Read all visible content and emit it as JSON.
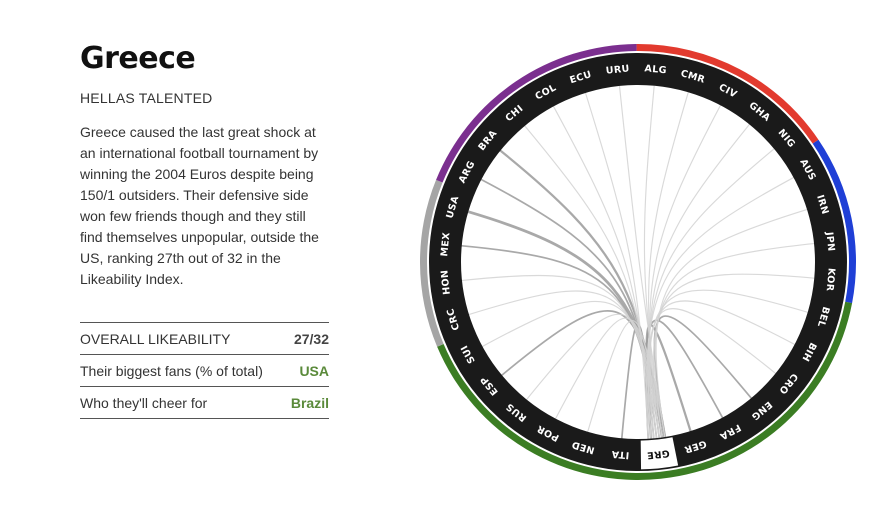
{
  "team": {
    "name": "Greece",
    "tagline": "HELLAS TALENTED",
    "description": "Greece caused the last great shock at an international football tournament by winning the 2004 Euros despite being 150/1 outsiders. Their defensive side won few friends though and they still find themselves unpopular, outside the US, ranking 27th out of 32 in the Likeability Index."
  },
  "stats": [
    {
      "label": "OVERALL LIKEABILITY",
      "value": "27/32",
      "style": "rank"
    },
    {
      "label": "Their biggest fans (% of total)",
      "value": "USA",
      "style": "green"
    },
    {
      "label": "Who they'll cheer for",
      "value": "Brazil",
      "style": "green"
    }
  ],
  "chart_data": {
    "type": "chord",
    "selected": "GRE",
    "teams": [
      "URU",
      "ALG",
      "CMR",
      "CIV",
      "GHA",
      "NIG",
      "AUS",
      "IRN",
      "JPN",
      "KOR",
      "BEL",
      "BIH",
      "CRO",
      "ENG",
      "FRA",
      "GER",
      "GRE",
      "ITA",
      "NED",
      "POR",
      "RUS",
      "ESP",
      "SUI",
      "CRC",
      "HON",
      "MEX",
      "USA",
      "ARG",
      "BRA",
      "CHI",
      "COL",
      "ECU"
    ],
    "groups": [
      {
        "color": "#e23a2e",
        "teams": [
          "ALG",
          "CMR",
          "CIV",
          "GHA",
          "NIG"
        ]
      },
      {
        "color": "#1f3fd6",
        "teams": [
          "AUS",
          "IRN",
          "JPN",
          "KOR"
        ]
      },
      {
        "color": "#3b7d23",
        "teams": [
          "BEL",
          "BIH",
          "CRO",
          "ENG",
          "FRA",
          "GER",
          "GRE",
          "ITA",
          "NED",
          "POR",
          "RUS",
          "ESP",
          "SUI"
        ]
      },
      {
        "color": "#a5a5a5",
        "teams": [
          "CRC",
          "HON",
          "MEX",
          "USA"
        ]
      },
      {
        "color": "#7b2f8f",
        "teams": [
          "ARG",
          "BRA",
          "CHI",
          "COL",
          "ECU",
          "URU"
        ]
      }
    ],
    "links": [
      {
        "target": "USA",
        "weight": 4
      },
      {
        "target": "BRA",
        "weight": 3
      },
      {
        "target": "ARG",
        "weight": 2
      },
      {
        "target": "MEX",
        "weight": 2
      },
      {
        "target": "ITA",
        "weight": 2
      },
      {
        "target": "GER",
        "weight": 3
      },
      {
        "target": "FRA",
        "weight": 2
      },
      {
        "target": "ENG",
        "weight": 2
      },
      {
        "target": "ESP",
        "weight": 2
      },
      {
        "target": "NED",
        "weight": 1
      },
      {
        "target": "POR",
        "weight": 1
      },
      {
        "target": "CRO",
        "weight": 1
      },
      {
        "target": "BIH",
        "weight": 1
      },
      {
        "target": "BEL",
        "weight": 1
      },
      {
        "target": "RUS",
        "weight": 1
      },
      {
        "target": "SUI",
        "weight": 1
      },
      {
        "target": "CRC",
        "weight": 1
      },
      {
        "target": "HON",
        "weight": 1
      },
      {
        "target": "CHI",
        "weight": 1
      },
      {
        "target": "COL",
        "weight": 1
      },
      {
        "target": "ECU",
        "weight": 1
      },
      {
        "target": "URU",
        "weight": 1
      },
      {
        "target": "ALG",
        "weight": 1
      },
      {
        "target": "CMR",
        "weight": 1
      },
      {
        "target": "CIV",
        "weight": 1
      },
      {
        "target": "GHA",
        "weight": 1
      },
      {
        "target": "NIG",
        "weight": 1
      },
      {
        "target": "AUS",
        "weight": 1
      },
      {
        "target": "IRN",
        "weight": 1
      },
      {
        "target": "JPN",
        "weight": 1
      },
      {
        "target": "KOR",
        "weight": 1
      }
    ]
  }
}
